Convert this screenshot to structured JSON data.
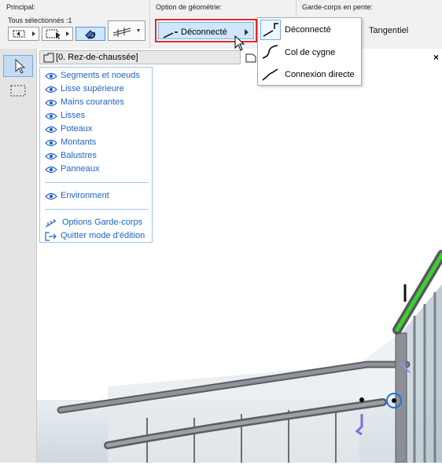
{
  "toolbar": {
    "principal_label": "Principal:",
    "selection_label": "Tous sélectionnés :1",
    "geometry_label": "Option de géométrie:",
    "geometry_value": "Déconnecté",
    "garde_label": "Garde-corps en pente:",
    "garde_value": "Tangentiel"
  },
  "dropdown": {
    "items": [
      {
        "label": "Déconnecté",
        "icon": "disconnected-icon"
      },
      {
        "label": "Col de cygne",
        "icon": "gooseneck-icon"
      },
      {
        "label": "Connexion directe",
        "icon": "direct-connection-icon"
      }
    ],
    "selected_index": 0
  },
  "view": {
    "tab_label": "[0. Rez-de-chaussée]",
    "close_label": "×"
  },
  "panel": {
    "items": [
      {
        "label": "Segments et noeuds",
        "icon": "eye-icon"
      },
      {
        "label": "Lisse supérieure",
        "icon": "eye-icon"
      },
      {
        "label": "Mains courantes",
        "icon": "eye-icon"
      },
      {
        "label": "Lisses",
        "icon": "eye-icon"
      },
      {
        "label": "Poteaux",
        "icon": "eye-icon"
      },
      {
        "label": "Montants",
        "icon": "eye-icon"
      },
      {
        "label": "Balustres",
        "icon": "eye-icon"
      },
      {
        "label": "Panneaux",
        "icon": "eye-icon"
      }
    ],
    "environment_label": "Environment",
    "options_label": "Options Garde-corps",
    "quit_label": "Quitter mode d'édition"
  },
  "colors": {
    "highlight_red": "#e0282c",
    "link_blue": "#1e63c8",
    "selection_blue": "#cfe6fb",
    "rail_green": "#3ccf2e"
  }
}
